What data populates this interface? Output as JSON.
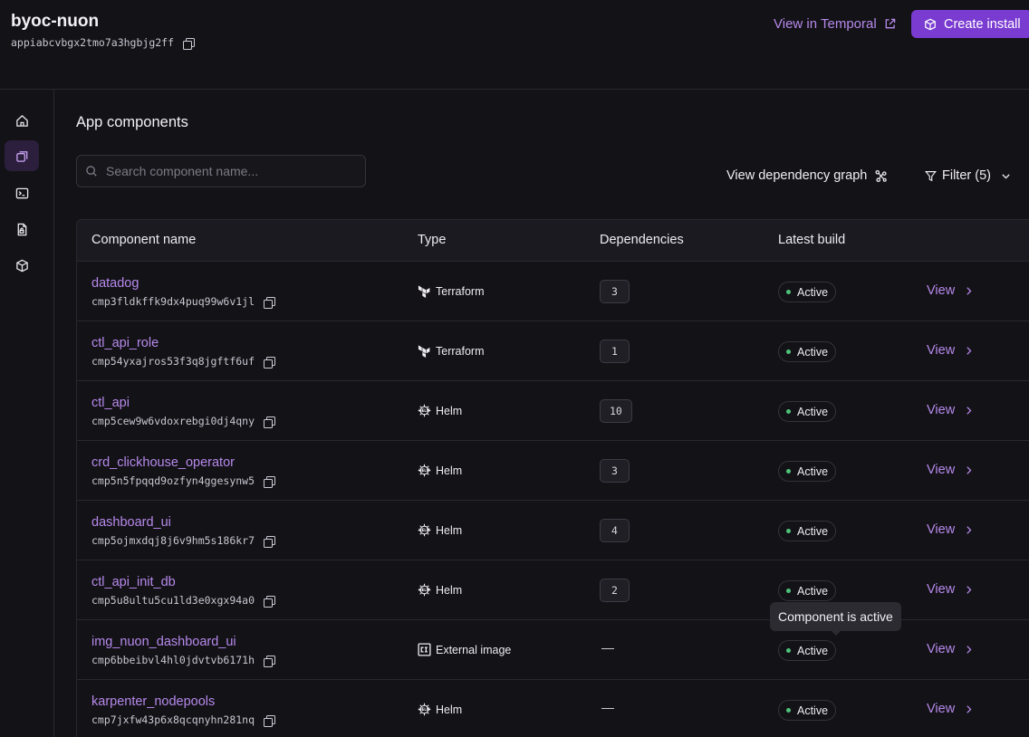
{
  "header": {
    "app_name": "byoc-nuon",
    "app_id": "appiabcvbgx2tmo7a3hgbjg2ff",
    "temporal_link": "View in Temporal",
    "create_button": "Create install"
  },
  "sidebar": {
    "items": [
      {
        "name": "home",
        "icon": "home-icon",
        "active": false
      },
      {
        "name": "components",
        "icon": "components-icon",
        "active": true
      },
      {
        "name": "terminal",
        "icon": "terminal-icon",
        "active": false
      },
      {
        "name": "file",
        "icon": "file-lock-icon",
        "active": false
      },
      {
        "name": "package",
        "icon": "package-icon",
        "active": false
      }
    ]
  },
  "main": {
    "title": "App components",
    "search_placeholder": "Search component name...",
    "dependency_graph_label": "View dependency graph",
    "filter_label": "Filter (5)",
    "columns": [
      "Component name",
      "Type",
      "Dependencies",
      "Latest build"
    ],
    "view_label": "View",
    "rows": [
      {
        "name": "datadog",
        "id": "cmp3fldkffk9dx4puq99w6v1jl",
        "type": "Terraform",
        "type_icon": "terraform-icon",
        "dependencies": "3",
        "status": "Active"
      },
      {
        "name": "ctl_api_role",
        "id": "cmp54yxajros53f3q8jgftf6uf",
        "type": "Terraform",
        "type_icon": "terraform-icon",
        "dependencies": "1",
        "status": "Active"
      },
      {
        "name": "ctl_api",
        "id": "cmp5cew9w6vdoxrebgi0dj4qny",
        "type": "Helm",
        "type_icon": "helm-icon",
        "dependencies": "10",
        "status": "Active"
      },
      {
        "name": "crd_clickhouse_operator",
        "id": "cmp5n5fpqqd9ozfyn4ggesynw5",
        "type": "Helm",
        "type_icon": "helm-icon",
        "dependencies": "3",
        "status": "Active"
      },
      {
        "name": "dashboard_ui",
        "id": "cmp5ojmxdqj8j6v9hm5s186kr7",
        "type": "Helm",
        "type_icon": "helm-icon",
        "dependencies": "4",
        "status": "Active"
      },
      {
        "name": "ctl_api_init_db",
        "id": "cmp5u8ultu5cu1ld3e0xgx94a0",
        "type": "Helm",
        "type_icon": "helm-icon",
        "dependencies": "2",
        "status": "Active"
      },
      {
        "name": "img_nuon_dashboard_ui",
        "id": "cmp6bbeibvl4hl0jdvtvb6171h",
        "type": "External image",
        "type_icon": "container-image-icon",
        "dependencies": "—",
        "status": "Active"
      },
      {
        "name": "karpenter_nodepools",
        "id": "cmp7jxfw43p6x8qcqnyhn281nq",
        "type": "Helm",
        "type_icon": "helm-icon",
        "dependencies": "—",
        "status": "Active"
      }
    ],
    "tooltip": "Component is active"
  },
  "colors": {
    "accent": "#7a3bd1",
    "link": "#b689ec",
    "status_active": "#4ec27a",
    "background": "#131216"
  }
}
